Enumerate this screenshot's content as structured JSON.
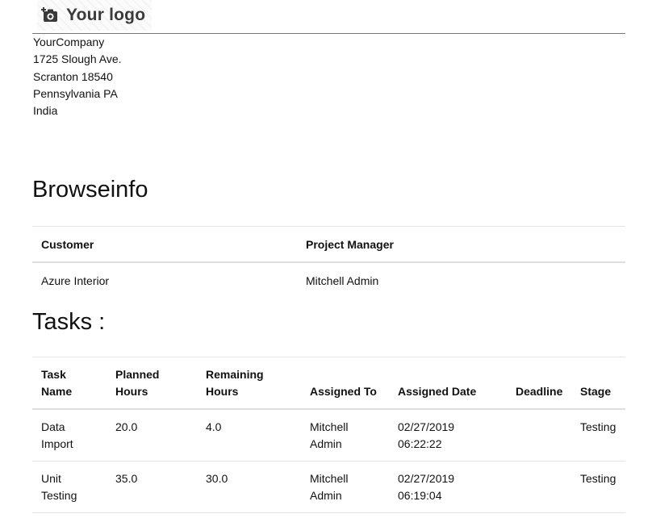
{
  "logo": {
    "text": "Your logo",
    "icon": "camera-plus-icon"
  },
  "company": {
    "lines": [
      "YourCompany",
      "1725 Slough Ave.",
      "Scranton 18540",
      "Pennsylvania PA",
      "India"
    ]
  },
  "project": {
    "name": "Browseinfo",
    "headers": {
      "customer": "Customer",
      "manager": "Project Manager"
    },
    "values": {
      "customer": "Azure Interior",
      "manager": "Mitchell Admin"
    }
  },
  "tasks": {
    "title": "Tasks :",
    "headers": {
      "name": [
        "Task",
        "Name"
      ],
      "planned": [
        "Planned",
        "Hours"
      ],
      "remaining": [
        "Remaining",
        "Hours"
      ],
      "assigned": "Assigned To",
      "date": "Assigned Date",
      "deadline": "Deadline",
      "stage": "Stage"
    },
    "rows": [
      {
        "name": [
          "Data",
          "Import"
        ],
        "planned": "20.0",
        "remaining": "4.0",
        "assigned": [
          "Mitchell",
          "Admin"
        ],
        "date": [
          "02/27/2019",
          "06:22:22"
        ],
        "deadline": "",
        "stage": "Testing"
      },
      {
        "name": [
          "Unit",
          "Testing"
        ],
        "planned": "35.0",
        "remaining": "30.0",
        "assigned": [
          "Mitchell",
          "Admin"
        ],
        "date": [
          "02/27/2019",
          "06:19:04"
        ],
        "deadline": "",
        "stage": "Testing"
      }
    ]
  }
}
